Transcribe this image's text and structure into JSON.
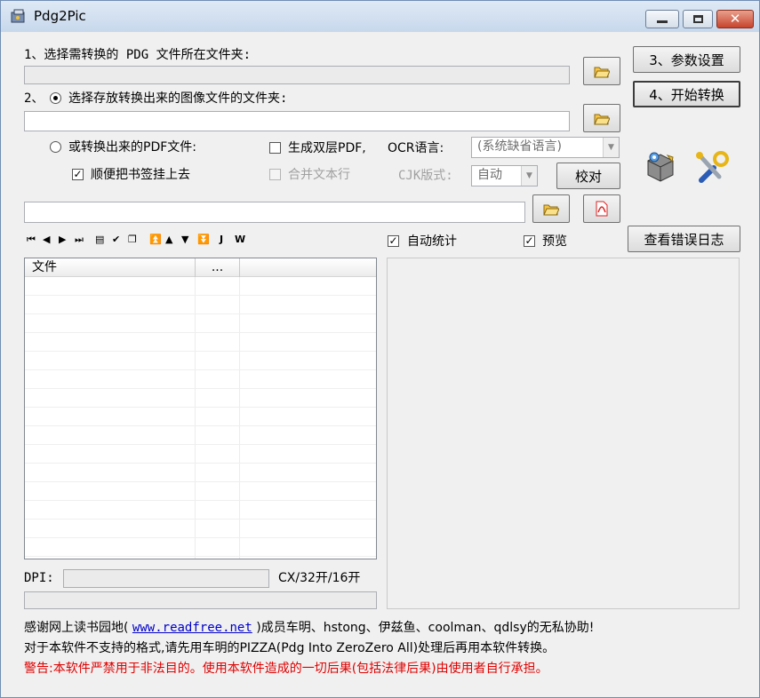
{
  "window": {
    "title": "Pdg2Pic"
  },
  "step1": {
    "label": "1、选择需转换的 PDG 文件所在文件夹:",
    "path_value": ""
  },
  "step2": {
    "prefix": "2、",
    "label": "选择存放转换出来的图像文件的文件夹:",
    "path_value": ""
  },
  "pdf_option": {
    "label": "或转换出来的PDF文件:",
    "double_layer_label": "生成双层PDF,",
    "ocr_label": "OCR语言:",
    "ocr_value": "(系统缺省语言)",
    "bookmark_label": "顺便把书签挂上去",
    "merge_label": "合并文本行",
    "cjk_label": "CJK版式:",
    "cjk_value": "自动",
    "proof_button": "校对"
  },
  "buttons": {
    "settings": "3、参数设置",
    "start": "4、开始转换",
    "error_log": "查看错误日志"
  },
  "options": {
    "auto_stat_label": "自动统计",
    "preview_label": "预览"
  },
  "file_list": {
    "columns": [
      "文件",
      "..."
    ]
  },
  "status": {
    "dpi_label": "DPI:",
    "dpi_value": "",
    "size_text": "CX/32开/16开"
  },
  "footer": {
    "thanks_prefix": "感谢网上读书园地(",
    "thanks_link": "www.readfree.net",
    "thanks_suffix": ")成员车明、hstong、伊兹鱼、coolman、qdlsy的无私协助!",
    "note": "对于本软件不支持的格式,请先用车明的PIZZA(Pdg Into ZeroZero All)处理后再用本软件转换。",
    "warning": "警告:本软件严禁用于非法目的。使用本软件造成的一切后果(包括法律后果)由使用者自行承担。"
  }
}
